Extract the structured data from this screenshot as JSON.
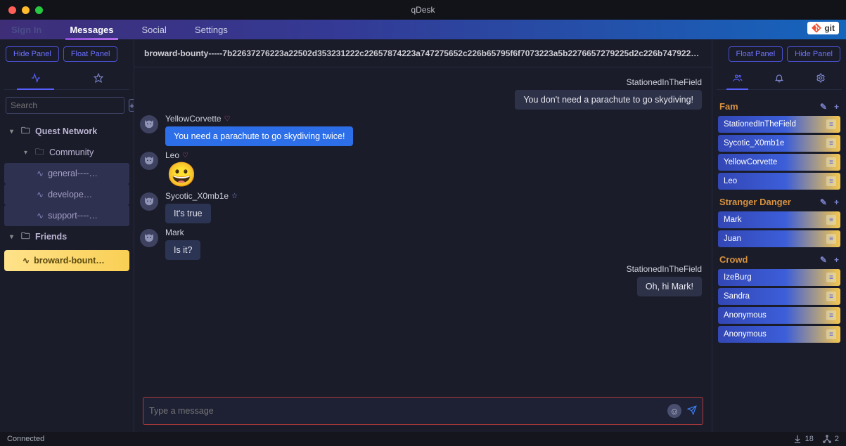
{
  "window": {
    "title": "qDesk"
  },
  "topbar": {
    "signin": "Sign In",
    "tabs": [
      "Messages",
      "Social",
      "Settings"
    ],
    "git_label": "git"
  },
  "left": {
    "hide_btn": "Hide Panel",
    "float_btn": "Float Panel",
    "search_placeholder": "Search",
    "tree": {
      "root": "Quest Network",
      "community": "Community",
      "channels": [
        "general----…",
        "develope…",
        "support----…"
      ],
      "friends": "Friends",
      "selected_friend": "broward-bount…"
    }
  },
  "right": {
    "float_btn": "Float Panel",
    "hide_btn": "Hide Panel",
    "groups": [
      {
        "title": "Fam",
        "members": [
          "StationedInTheField",
          "Sycotic_X0mb1e",
          "YellowCorvette",
          "Leo"
        ]
      },
      {
        "title": "Stranger Danger",
        "members": [
          "Mark",
          "Juan"
        ]
      },
      {
        "title": "Crowd",
        "members": [
          "IzeBurg",
          "Sandra",
          "Anonymous",
          "Anonymous"
        ]
      }
    ]
  },
  "channel": {
    "header": "broward-bounty-----7b22637276223a22502d353231222c22657874223a747275652c226b65795f6f7073223a5b2276657279225d2c226b7479223a224543222…"
  },
  "messages": [
    {
      "side": "right",
      "name": "StationedInTheField",
      "text": "You don't need a parachute to go skydiving!",
      "style": "dark"
    },
    {
      "side": "left",
      "name": "YellowCorvette",
      "badge": "heart",
      "text": "You need a parachute to go skydiving twice!",
      "style": "blue"
    },
    {
      "side": "left",
      "name": "Leo",
      "badge": "heart",
      "emoji": "😀"
    },
    {
      "side": "left",
      "name": "Sycotic_X0mb1e",
      "badge": "star",
      "text": "It's true",
      "style": "dblue"
    },
    {
      "side": "left",
      "name": "Mark",
      "text": "Is it?",
      "style": "dblue"
    },
    {
      "side": "right",
      "name": "StationedInTheField",
      "text": "Oh, hi Mark!",
      "style": "dark"
    }
  ],
  "composer": {
    "placeholder": "Type a message"
  },
  "status": {
    "left": "Connected",
    "downloads": "18",
    "peers": "2"
  }
}
